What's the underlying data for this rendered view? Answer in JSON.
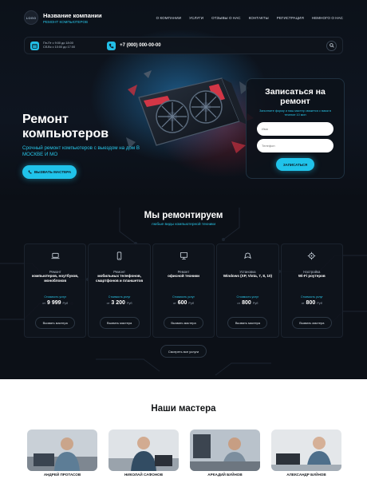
{
  "header": {
    "logo_text": "LOGO",
    "company_name": "Название компании",
    "company_sub": "РЕМОНТ КОМПЬЮТЕРОВ",
    "nav": [
      "О КОМПАНИИ",
      "УСЛУГИ",
      "ОТЗЫВЫ О НАС",
      "КОНТАКТЫ",
      "РЕГИСТРАЦИЯ",
      "НЕМНОГО О НАС"
    ]
  },
  "contact": {
    "hours_line1": "Пн-Пт с 9:00 до 18:00",
    "hours_line2": "Сб-Вс с 10:00 до 17:00",
    "phone": "+7 (000) 000-00-00"
  },
  "hero": {
    "title": "Ремонт компьютеров",
    "subtitle": "Срочный ремонт компьютеров с выездом на дом В МОСКВЕ И МО",
    "cta": "ВЫЗВАТЬ МАСТЕРА"
  },
  "form": {
    "title": "Записаться на ремонт",
    "note": "Заполните форму и наш мастер свяжется с вами в течение 10 мин",
    "name_placeholder": "Имя",
    "phone_placeholder": "Телефон",
    "submit": "ЗАПИСАТЬСЯ"
  },
  "services": {
    "title": "Мы ремонтируем",
    "subtitle": "любые виды компьютерной техники",
    "price_label": "Стоимость услуг",
    "price_prefix": "от",
    "currency": "Руб",
    "button": "Вызвать мастера",
    "all_button": "Смотреть все услуги",
    "items": [
      {
        "icon": "laptop-icon",
        "l1": "Ремонт",
        "l2": "компьютеров, ноутбуков, моноблоков",
        "price": "9 999"
      },
      {
        "icon": "smartphone-icon",
        "l1": "Ремонт",
        "l2": "мобильных телефонов, смартфонов и планшетов",
        "price": "3 200"
      },
      {
        "icon": "monitor-icon",
        "l1": "Ремонт",
        "l2": "офисной техники",
        "price": "600"
      },
      {
        "icon": "windows-icon",
        "l1": "Установка",
        "l2": "Windows (XP, Vista, 7, 8, 10)",
        "price": "800"
      },
      {
        "icon": "wifi-gear-icon",
        "l1": "Настройка",
        "l2": "Wi-Fi роутеров",
        "price": "800"
      }
    ]
  },
  "masters": {
    "title": "Наши мастера",
    "names": [
      "АНДРЕЙ ПРОТАСОВ",
      "НИКОЛАЙ САФОНОВ",
      "АРКАДИЙ БУЙНОВ",
      "АЛЕКСАНДР БУЙНОВ"
    ]
  },
  "colors": {
    "accent": "#20c3ea",
    "dark_bg": "#0b0f16",
    "light_bg": "#ffffff"
  }
}
